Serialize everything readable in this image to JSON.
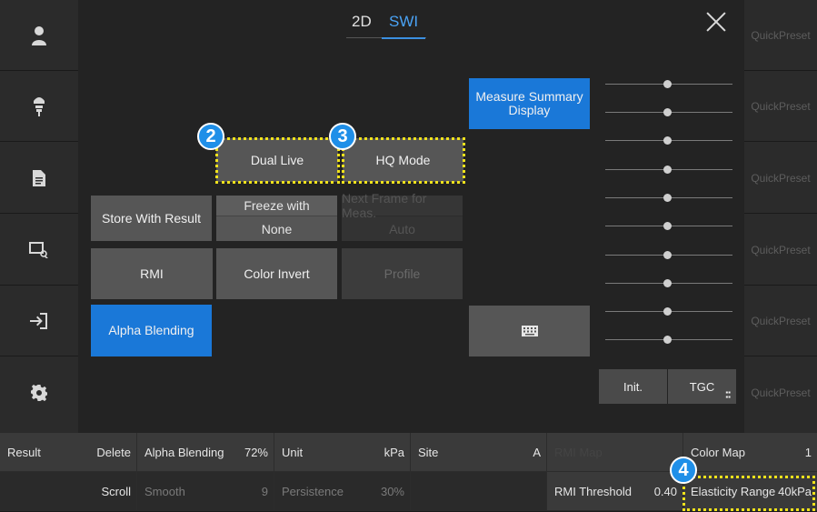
{
  "tabs": {
    "tab_2d": "2D",
    "tab_swi": "SWI"
  },
  "left_sidebar": [
    "user-icon",
    "probe-icon",
    "document-icon",
    "image-search-icon",
    "exit-icon",
    "gear-icon"
  ],
  "buttons": {
    "measure_summary": "Measure Summary\nDisplay",
    "dual_live": "Dual Live",
    "hq_mode": "HQ Mode",
    "store_with_result": "Store With Result",
    "freeze_with_label": "Freeze with",
    "freeze_with_value": "None",
    "next_frame_label": "Next Frame for Meas.",
    "next_frame_value": "Auto",
    "rmi": "RMI",
    "color_invert": "Color Invert",
    "profile": "Profile",
    "alpha_blending": "Alpha Blending",
    "init": "Init.",
    "tgc": "TGC"
  },
  "badges": {
    "b2": "2",
    "b3": "3",
    "b4": "4"
  },
  "quick_presets": [
    "QuickPreset",
    "QuickPreset",
    "QuickPreset",
    "QuickPreset",
    "QuickPreset",
    "QuickPreset"
  ],
  "bottom": {
    "result": "Result",
    "delete": "Delete",
    "scroll": "Scroll",
    "alpha_blending_label": "Alpha Blending",
    "alpha_blending_value": "72%",
    "smooth_label": "Smooth",
    "smooth_value": "9",
    "unit_label": "Unit",
    "unit_value": "kPa",
    "persistence_label": "Persistence",
    "persistence_value": "30%",
    "site_label": "Site",
    "site_value": "A",
    "rmi_map_label": "RMI Map",
    "rmi_threshold_label": "RMI Threshold",
    "rmi_threshold_value": "0.40",
    "color_map_label": "Color Map",
    "color_map_value": "1",
    "elasticity_range_label": "Elasticity Range",
    "elasticity_range_value": "40kPa"
  },
  "colors": {
    "accent_blue": "#1a78d8",
    "highlight_yellow": "#f0e21c",
    "badge_blue": "#1f8fe8"
  }
}
